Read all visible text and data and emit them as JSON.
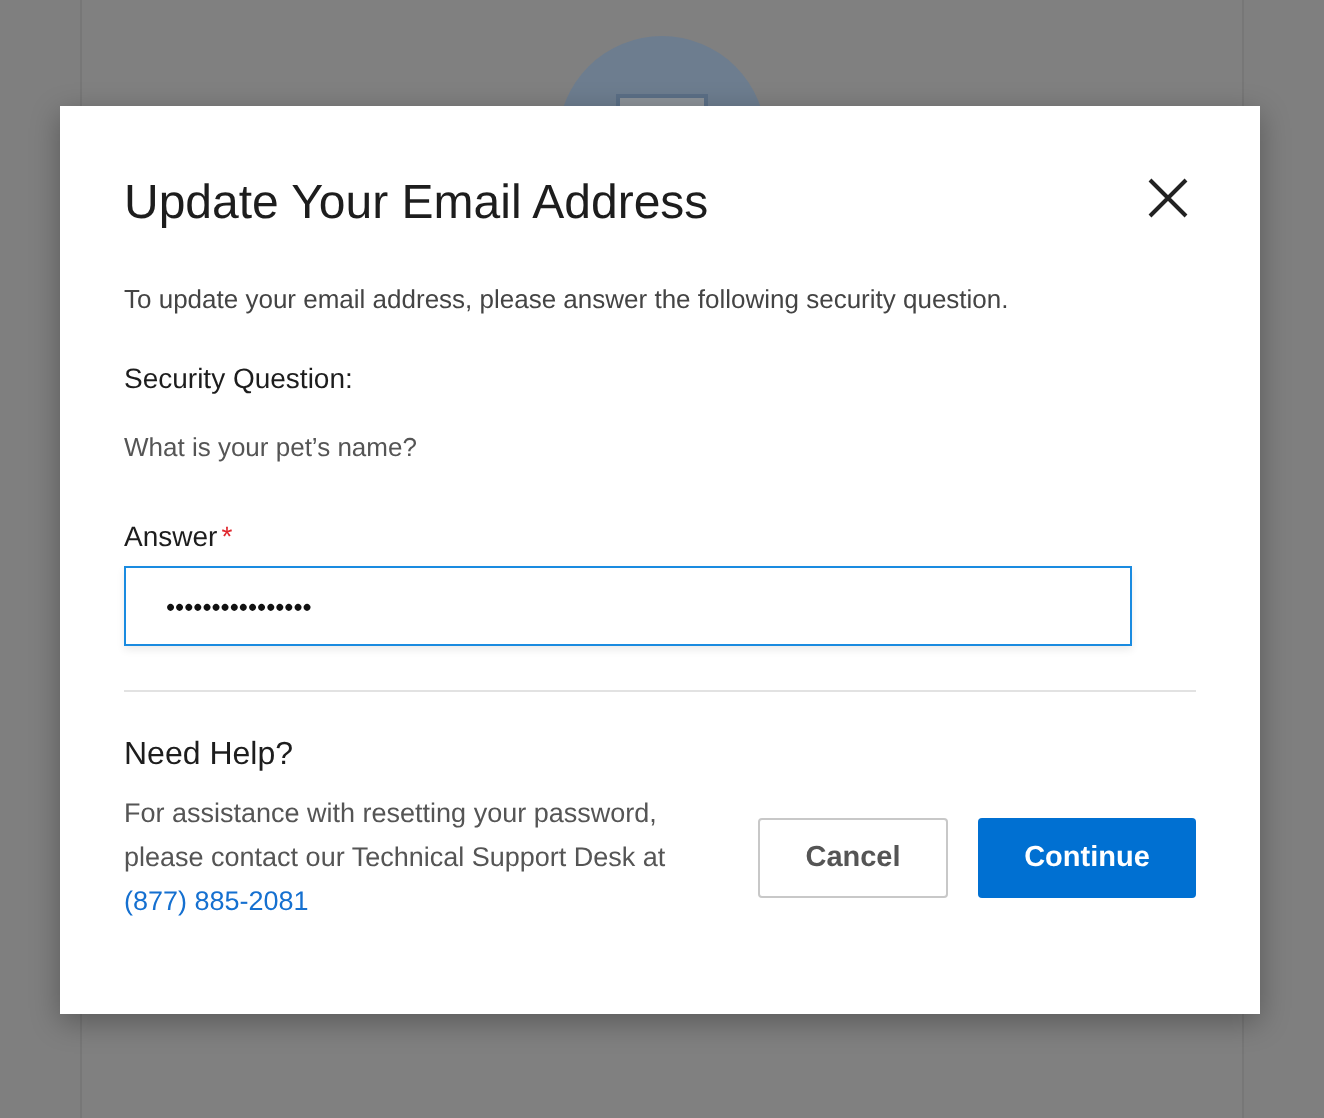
{
  "dialog": {
    "title": "Update Your Email Address",
    "intro": "To update your email address, please answer the following security question.",
    "security_question": {
      "label": "Security Question:",
      "text": "What is your pet’s name?"
    },
    "answer": {
      "label": "Answer",
      "required_mark": "*",
      "value": "••••••••••••••••",
      "focused": true
    },
    "help": {
      "title": "Need Help?",
      "text": "For assistance with resetting your password, please contact our Technical Support Desk at",
      "phone": "(877) 885-2081"
    },
    "buttons": [
      {
        "label": "Cancel",
        "kind": "secondary"
      },
      {
        "label": "Continue",
        "kind": "primary"
      }
    ]
  }
}
